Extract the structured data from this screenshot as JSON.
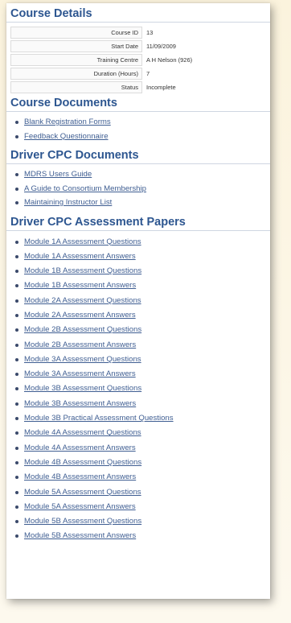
{
  "course_details": {
    "heading": "Course Details",
    "fields": [
      {
        "label": "Course ID",
        "value": "13"
      },
      {
        "label": "Start Date",
        "value": "11/09/2009"
      },
      {
        "label": "Training Centre",
        "value": "A H Nelson (926)"
      },
      {
        "label": "Duration (Hours)",
        "value": "7"
      },
      {
        "label": "Status",
        "value": "Incomplete"
      }
    ]
  },
  "course_documents": {
    "heading": "Course Documents",
    "items": [
      "Blank Registration Forms",
      "Feedback Questionnaire"
    ]
  },
  "cpc_documents": {
    "heading": "Driver CPC Documents",
    "items": [
      "MDRS Users Guide",
      "A Guide to Consortium Membership",
      "Maintaining Instructor List"
    ]
  },
  "assessment_papers": {
    "heading": "Driver CPC Assessment Papers",
    "items": [
      "Module 1A Assessment Questions",
      "Module 1A Assessment Answers",
      "Module 1B Assessment Questions",
      "Module 1B Assessment Answers",
      "Module 2A Assessment Questions",
      "Module 2A Assessment Answers",
      "Module 2B Assessment Questions",
      "Module 2B Assessment Answers",
      "Module 3A Assessment Questions",
      "Module 3A Assessment Answers",
      "Module 3B Assessment Questions",
      "Module 3B Assessment Answers",
      "Module 3B Practical Assessment Questions",
      "Module 4A Assessment Questions",
      "Module 4A Assessment Answers",
      "Module 4B Assessment Questions",
      "Module 4B Assessment Answers",
      "Module 5A Assessment Questions",
      "Module 5A Assessment Answers",
      "Module 5B Assessment Questions",
      "Module 5B Assessment Answers"
    ]
  }
}
